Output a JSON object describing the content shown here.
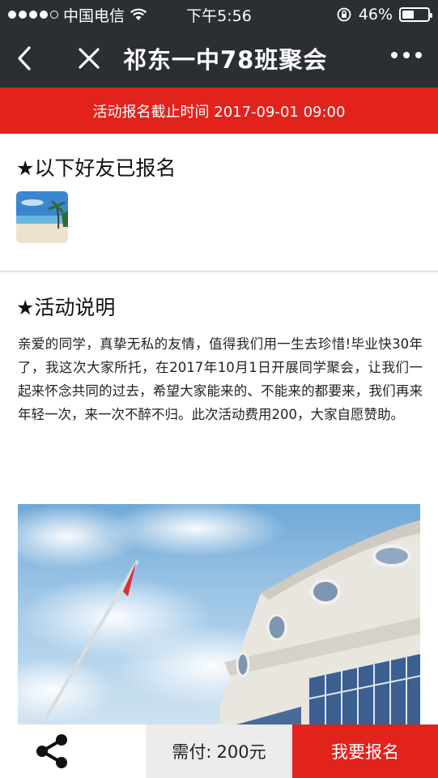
{
  "status_bar": {
    "carrier": "中国电信",
    "time": "下午5:56",
    "battery": "46%",
    "battery_level": 0.46
  },
  "nav": {
    "title": "祁东一中78班聚会"
  },
  "deadline": {
    "text": "活动报名截止时间 2017-09-01 09:00"
  },
  "friends_section": {
    "title": "★以下好友已报名"
  },
  "activity_section": {
    "title": "★活动说明",
    "description": "亲爱的同学，真挚无私的友情，值得我们用一生去珍惜!毕业快30年了，我这次大家所托，在2017年10月1日开展同学聚会，让我们一起来怀念共同的过去，希望大家能来的、不能来的都要来，我们再来年轻一次，来一次不醉不归。此次活动费用200，大家自愿赞助。"
  },
  "bottom_bar": {
    "pay_label": "需付:",
    "pay_amount": "200元",
    "signup_label": "我要报名"
  },
  "colors": {
    "header_bg": "#2b2f33",
    "accent_red": "#e2231c"
  }
}
